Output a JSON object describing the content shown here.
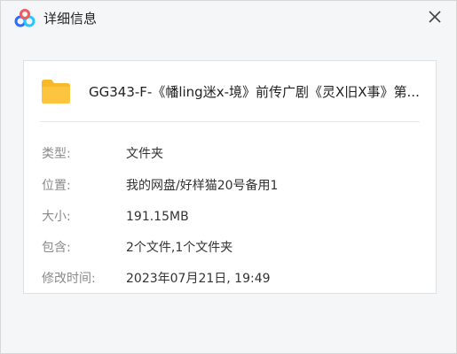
{
  "window": {
    "title": "详细信息",
    "close_icon": "close-icon",
    "logo_icon": "baidu-netdisk-logo-icon"
  },
  "file": {
    "name": "GG343-F-《幡ling迷x-境》前传广剧《灵X旧X事》第...",
    "icon": "folder-icon",
    "icon_color": "#fdc440"
  },
  "details": {
    "type_label": "类型:",
    "type_value": "文件夹",
    "location_label": "位置:",
    "location_value": "我的网盘/好样猫20号备用1",
    "size_label": "大小:",
    "size_value": "191.15MB",
    "contains_label": "包含:",
    "contains_value": "2个文件,1个文件夹",
    "modified_label": "修改时间:",
    "modified_value": "2023年07月21日, 19:49"
  }
}
